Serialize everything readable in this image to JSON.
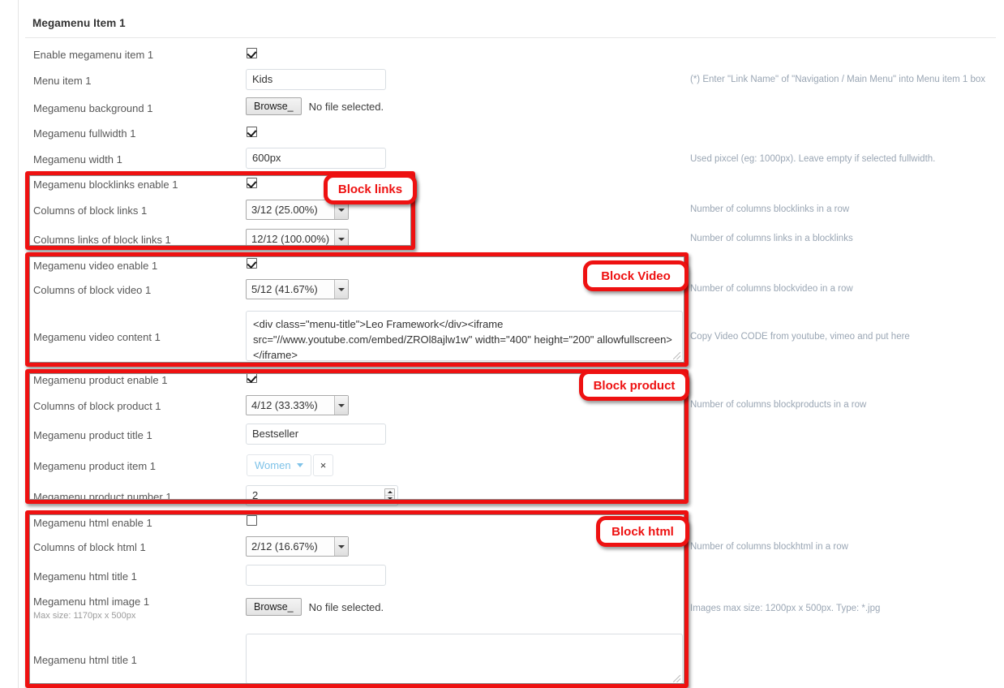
{
  "panel": {
    "title": "Megamenu Item 1"
  },
  "rows": {
    "enable_item": {
      "label": "Enable megamenu item 1",
      "checked": true
    },
    "menu_item": {
      "label": "Menu item 1",
      "value": "Kids",
      "hint": "(*) Enter \"Link Name\" of \"Navigation / Main Menu\" into Menu item 1 box"
    },
    "background": {
      "label": "Megamenu background 1",
      "browse": "Browse_",
      "file_status": "No file selected."
    },
    "fullwidth": {
      "label": "Megamenu fullwidth 1",
      "checked": true
    },
    "width": {
      "label": "Megamenu width 1",
      "value": "600px",
      "hint": "Used pixcel (eg: 1000px). Leave empty if selected fullwidth."
    },
    "blocklinks_enable": {
      "label": "Megamenu blocklinks enable 1",
      "checked": true
    },
    "columns_block_links": {
      "label": "Columns of block links 1",
      "value": "3/12 (25.00%)",
      "hint": "Number of columns blocklinks in a row"
    },
    "columns_links_of_block_links": {
      "label": "Columns links of block links 1",
      "value": "12/12 (100.00%)",
      "hint": "Number of columns links in a blocklinks"
    },
    "video_enable": {
      "label": "Megamenu video enable 1",
      "checked": true
    },
    "columns_block_video": {
      "label": "Columns of block video 1",
      "value": "5/12 (41.67%)",
      "hint": "Number of columns blockvideo in a row"
    },
    "video_content": {
      "label": "Megamenu video content 1",
      "value": "<div class=\"menu-title\">Leo Framework</div><iframe  src=\"//www.youtube.com/embed/ZROl8ajlw1w\" width=\"400\" height=\"200\"  allowfullscreen></iframe>",
      "hint": "Copy Video CODE from youtube, vimeo and put here"
    },
    "product_enable": {
      "label": "Megamenu product enable 1",
      "checked": true
    },
    "columns_block_product": {
      "label": "Columns of block product 1",
      "value": "4/12 (33.33%)",
      "hint": "Number of columns blockproducts in a row"
    },
    "product_title": {
      "label": "Megamenu product title 1",
      "value": "Bestseller"
    },
    "product_item": {
      "label": "Megamenu product item 1",
      "tag": "Women",
      "remove": "×"
    },
    "product_number": {
      "label": "Megamenu product number 1",
      "value": "2"
    },
    "html_enable": {
      "label": "Megamenu html enable 1",
      "checked": false
    },
    "columns_block_html": {
      "label": "Columns of block html 1",
      "value": "2/12 (16.67%)",
      "hint": "Number of columns blockhtml in a row"
    },
    "html_title": {
      "label": "Megamenu html title 1",
      "value": ""
    },
    "html_image": {
      "label": "Megamenu html image 1",
      "sublabel": "Max size: 1170px x 500px",
      "browse": "Browse_",
      "file_status": "No file selected.",
      "hint": "Images max size: 1200px x 500px. Type: *.jpg"
    },
    "html_title_2": {
      "label": "Megamenu html title 1",
      "value": ""
    }
  },
  "annotations": {
    "block_links": "Block links",
    "block_video": "Block Video",
    "block_product": "Block product",
    "block_html": "Block html",
    "accent_color": "#ee1111"
  }
}
